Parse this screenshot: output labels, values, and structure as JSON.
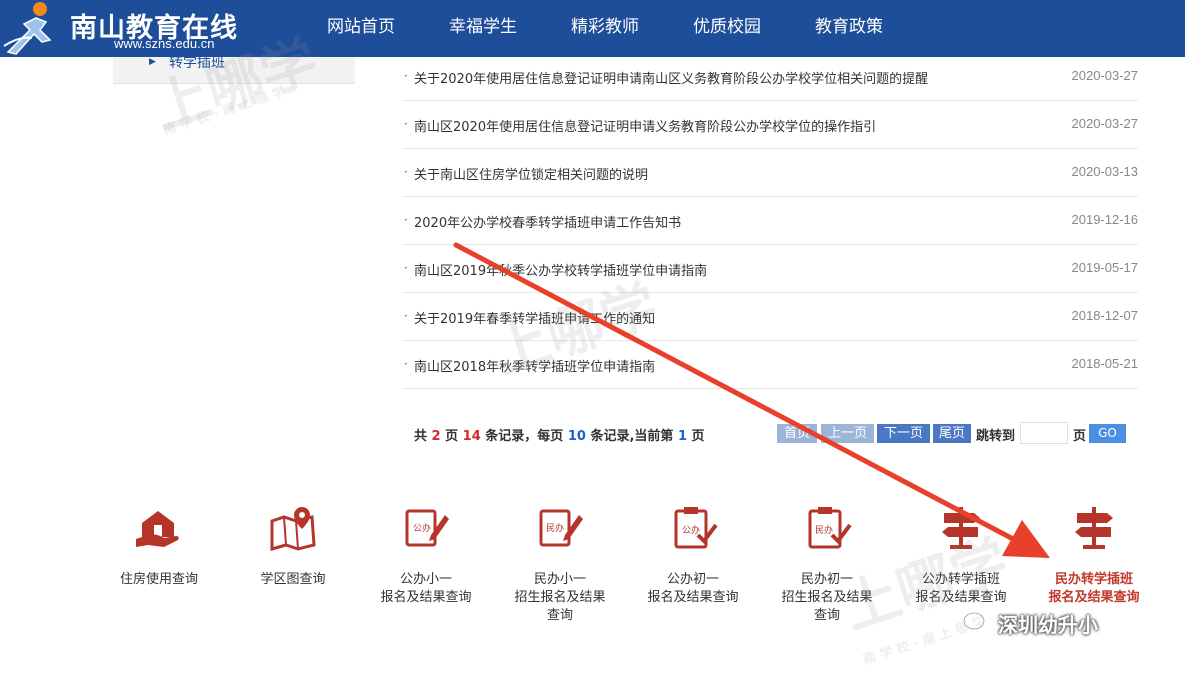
{
  "site": {
    "title": "南山教育在线",
    "url": "www.szns.edu.cn"
  },
  "nav": {
    "items": [
      "网站首页",
      "幸福学生",
      "精彩教师",
      "优质校园",
      "教育政策"
    ]
  },
  "sidebar": {
    "items": [
      {
        "label": "转学插班"
      }
    ]
  },
  "news": {
    "items": [
      {
        "title": "关于2020年使用居住信息登记证明申请南山区义务教育阶段公办学校学位相关问题的提醒",
        "date": "2020-03-27"
      },
      {
        "title": "南山区2020年使用居住信息登记证明申请义务教育阶段公办学校学位的操作指引",
        "date": "2020-03-27"
      },
      {
        "title": "关于南山区住房学位锁定相关问题的说明",
        "date": "2020-03-13"
      },
      {
        "title": "2020年公办学校春季转学插班申请工作告知书",
        "date": "2019-12-16"
      },
      {
        "title": "南山区2019年秋季公办学校转学插班学位申请指南",
        "date": "2019-05-17"
      },
      {
        "title": "关于2019年春季转学插班申请工作的通知",
        "date": "2018-12-07"
      },
      {
        "title": "南山区2018年秋季转学插班学位申请指南",
        "date": "2018-05-21"
      }
    ]
  },
  "pager": {
    "prefix": "共",
    "total_pages": "2",
    "page_unit": "页",
    "total_records": "14",
    "records_label": "条记录，每页",
    "per_page": "10",
    "per_page_label": "条记录,当前第",
    "current_page": "1",
    "suffix": "页",
    "first": "首页",
    "prev": "上一页",
    "next": "下一页",
    "last": "尾页",
    "jump_label": "跳转到",
    "jump_value": "",
    "page_label": "页",
    "go": "GO"
  },
  "quick_links": [
    {
      "line1": "住房使用查询",
      "line2": "",
      "line3": "",
      "icon": "house-hand-icon"
    },
    {
      "line1": "学区图查询",
      "line2": "",
      "line3": "",
      "icon": "map-pin-icon"
    },
    {
      "line1": "公办小一",
      "line2": "报名及结果查询",
      "line3": "",
      "icon": "public-doc-pen-icon",
      "stamp": "公办"
    },
    {
      "line1": "民办小一",
      "line2": "招生报名及结果",
      "line3": "查询",
      "icon": "private-doc-pen-icon",
      "stamp": "民办"
    },
    {
      "line1": "公办初一",
      "line2": "报名及结果查询",
      "line3": "",
      "icon": "public-clipboard-check-icon",
      "stamp": "公办"
    },
    {
      "line1": "民办初一",
      "line2": "招生报名及结果",
      "line3": "查询",
      "icon": "private-clipboard-check-icon",
      "stamp": "民办"
    },
    {
      "line1": "公办转学插班",
      "line2": "报名及结果查询",
      "line3": "",
      "icon": "signpost-icon"
    },
    {
      "line1": "民办转学插班",
      "line2": "报名及结果查询",
      "line3": "",
      "icon": "signpost-icon",
      "active": true
    }
  ],
  "watermark": {
    "text": "上哪学",
    "sub": "南 学 校 · 南 上 哪 学"
  },
  "footer": {
    "wechat_account": "深圳幼升小"
  },
  "colors": {
    "header_bg": "#1e4d99",
    "accent_red": "#c0392b",
    "arrow_red": "#e8402a",
    "icon_red": "#b5352a"
  }
}
